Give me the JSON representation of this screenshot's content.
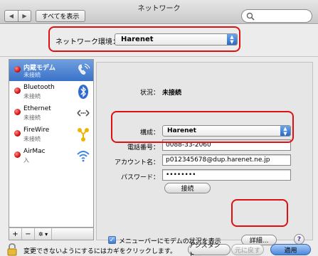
{
  "window": {
    "title": "ネットワーク"
  },
  "toolbar": {
    "back": "◀",
    "forward": "▶",
    "show_all_label": "すべてを表示",
    "search_placeholder": ""
  },
  "location": {
    "label": "ネットワーク環境：",
    "value": "Harenet"
  },
  "services": [
    {
      "name": "内蔵モデム",
      "status": "未接続",
      "icon": "modem-icon",
      "selected": true
    },
    {
      "name": "Bluetooth",
      "status": "未接続",
      "icon": "bluetooth-icon"
    },
    {
      "name": "Ethernet",
      "status": "未接続",
      "icon": "ethernet-icon"
    },
    {
      "name": "FireWire",
      "status": "未接続",
      "icon": "firewire-icon"
    },
    {
      "name": "AirMac",
      "status": "入",
      "icon": "airmac-icon"
    }
  ],
  "sidebar_toolbar": {
    "add": "+",
    "remove": "−",
    "action": "✲ ▾"
  },
  "detail": {
    "status_label": "状況：",
    "status_value": "未接続",
    "config_label": "構成：",
    "config_value": "Harenet",
    "phone_label": "電話番号：",
    "phone_value": "0088-33-2060",
    "account_label": "アカウント名：",
    "account_value": "p012345678@dup.harenet.ne.jp",
    "password_label": "パスワード：",
    "password_value": "••••••••",
    "connect_label": "接続",
    "menubar_checkbox_label": "メニューバーにモデムの状況を表示",
    "advanced_label": "詳細...",
    "help_label": "?"
  },
  "bottom": {
    "lock_text": "変更できないようにするにはカギをクリックします。",
    "assistant_label": "アシスタント...",
    "revert_label": "元に戻す",
    "apply_label": "適用"
  },
  "colors": {
    "highlight_red": "#e01010",
    "selection_blue": "#3a72c8",
    "status_red": "#d01010"
  }
}
